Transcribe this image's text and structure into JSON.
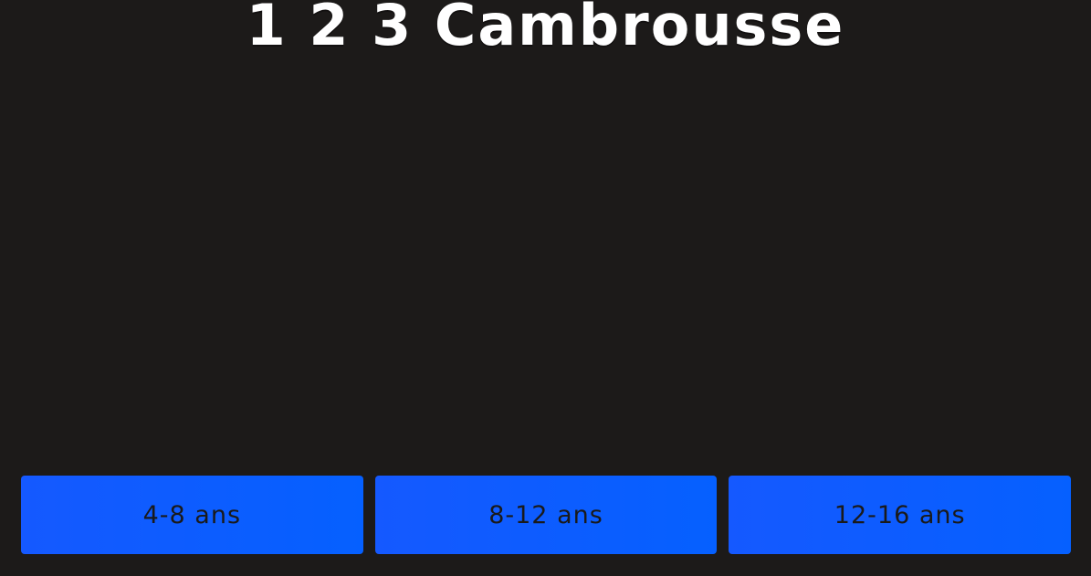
{
  "header": {
    "title": "1 2 3 Cambrousse"
  },
  "age_buttons": [
    {
      "label": "4-8 ans"
    },
    {
      "label": "8-12 ans"
    },
    {
      "label": "12-16 ans"
    }
  ],
  "colors": {
    "background": "#1c1a19",
    "title_text": "#ffffff",
    "button_background": "#0a5cff",
    "button_text": "#1a1a1a"
  }
}
